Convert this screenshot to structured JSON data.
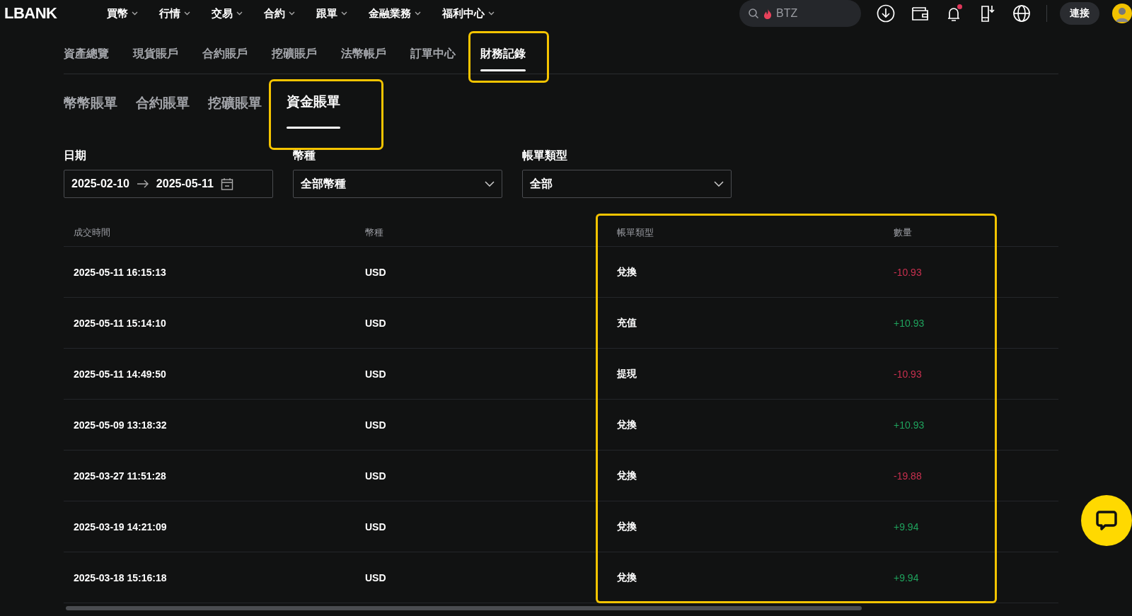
{
  "topbar": {
    "logo": "LBANK",
    "menu": [
      {
        "label": "買幣"
      },
      {
        "label": "行情"
      },
      {
        "label": "交易"
      },
      {
        "label": "合約"
      },
      {
        "label": "跟單"
      },
      {
        "label": "金融業務"
      },
      {
        "label": "福利中心"
      }
    ],
    "search": {
      "value": "BTZ"
    },
    "notification_dot": true,
    "connect_button": "連接"
  },
  "account_tabs": [
    {
      "label": "資產總覽",
      "selected": false,
      "highlighted": false
    },
    {
      "label": "現貨賬戶",
      "selected": false,
      "highlighted": false
    },
    {
      "label": "合約賬戶",
      "selected": false,
      "highlighted": false
    },
    {
      "label": "挖礦賬戶",
      "selected": false,
      "highlighted": false
    },
    {
      "label": "法幣帳戶",
      "selected": false,
      "highlighted": false
    },
    {
      "label": "訂單中心",
      "selected": false,
      "highlighted": false
    },
    {
      "label": "財務記錄",
      "selected": true,
      "highlighted": true
    }
  ],
  "bill_tabs": [
    {
      "label": "幣幣賬單",
      "selected": false,
      "highlighted": false
    },
    {
      "label": "合約賬單",
      "selected": false,
      "highlighted": false
    },
    {
      "label": "挖礦賬單",
      "selected": false,
      "highlighted": false
    },
    {
      "label": "資金賬單",
      "selected": true,
      "highlighted": true
    }
  ],
  "filters": [
    {
      "kind": "daterange",
      "label": "日期",
      "start": "2025-02-10",
      "end": "2025-05-11"
    },
    {
      "kind": "select",
      "label": "幣種",
      "value": "全部幣種"
    },
    {
      "kind": "select",
      "label": "帳單類型",
      "value": "全部"
    }
  ],
  "table": {
    "columns": [
      {
        "label": "成交時間",
        "highlighted": false
      },
      {
        "label": "幣種",
        "highlighted": false
      },
      {
        "label": "帳單類型",
        "highlighted": true
      },
      {
        "label": "數量",
        "highlighted": true
      }
    ],
    "rows": [
      {
        "time": "2025-05-11 16:15:13",
        "currency": "USD",
        "type": "兌換",
        "amount": "-10.93",
        "color": "#c9304f"
      },
      {
        "time": "2025-05-11 15:14:10",
        "currency": "USD",
        "type": "充值",
        "amount": "+10.93",
        "color": "#1fa35d"
      },
      {
        "time": "2025-05-11 14:49:50",
        "currency": "USD",
        "type": "提現",
        "amount": "-10.93",
        "color": "#c9304f"
      },
      {
        "time": "2025-05-09 13:18:32",
        "currency": "USD",
        "type": "兌換",
        "amount": "+10.93",
        "color": "#1fa35d"
      },
      {
        "time": "2025-03-27 11:51:28",
        "currency": "USD",
        "type": "兌換",
        "amount": "-19.88",
        "color": "#c9304f"
      },
      {
        "time": "2025-03-19 14:21:09",
        "currency": "USD",
        "type": "兌換",
        "amount": "+9.94",
        "color": "#1fa35d"
      },
      {
        "time": "2025-03-18 15:16:18",
        "currency": "USD",
        "type": "兌換",
        "amount": "+9.94",
        "color": "#1fa35d"
      }
    ]
  }
}
